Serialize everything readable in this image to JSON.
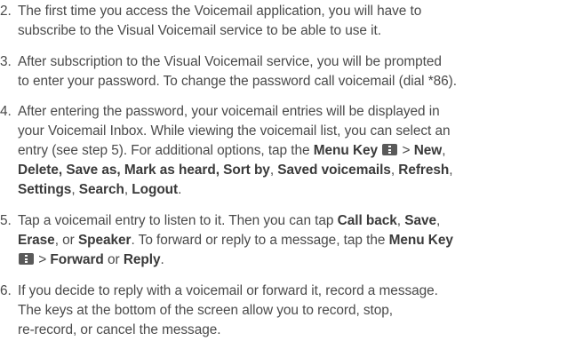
{
  "steps": [
    {
      "number": "2.",
      "line1": "The first time you access the Voicemail application, you will have to",
      "line2": "subscribe to the Visual Voicemail service to be able to use it."
    },
    {
      "number": "3.",
      "line1": "After subscription to the Visual Voicemail service, you will be prompted",
      "line2": "to enter your password. To change the password call voicemail (dial *86)."
    },
    {
      "number": "4.",
      "line1": "After entering the password, your voicemail entries will be displayed in",
      "line2": "your Voicemail Inbox. While viewing the voicemail list, you can select an",
      "line3_a": "entry (see step 5). For additional options, tap the ",
      "line3_menu_key": "Menu Key",
      "line3_b": " > ",
      "line3_new": "New",
      "line3_c": ",",
      "line4_delete": "Delete",
      "line4_a": ", ",
      "line4_save_as": "Save as",
      "line4_b": ", ",
      "line4_mark": "Mark as heard",
      "line4_c": ", ",
      "line4_sort": "Sort by",
      "line4_d": ", ",
      "line4_saved": "Saved voicemails",
      "line4_e": ", ",
      "line4_refresh": "Refresh",
      "line4_f": ",",
      "line5_settings": "Settings",
      "line5_a": ", ",
      "line5_search": "Search",
      "line5_b": ", ",
      "line5_logout": "Logout",
      "line5_c": "."
    },
    {
      "number": "5.",
      "line1_a": "Tap a voicemail entry to listen to it. Then you can tap ",
      "line1_callback": "Call back",
      "line1_b": ", ",
      "line1_save": "Save",
      "line1_c": ",",
      "line2_erase": "Erase",
      "line2_a": ", or ",
      "line2_speaker": "Speaker",
      "line2_b": ". To forward or reply to a message, tap the ",
      "line2_menu_key": "Menu Key",
      "line3_a": " > ",
      "line3_forward": "Forward",
      "line3_b": " or ",
      "line3_reply": "Reply",
      "line3_c": "."
    },
    {
      "number": "6.",
      "line1": "If you decide to reply with a voicemail or forward it, record a message.",
      "line2": "The keys at the bottom of the screen allow you to record, stop,",
      "line3": "re-record, or cancel the message."
    }
  ],
  "icons": {
    "menu_key": "menu-key-icon"
  }
}
